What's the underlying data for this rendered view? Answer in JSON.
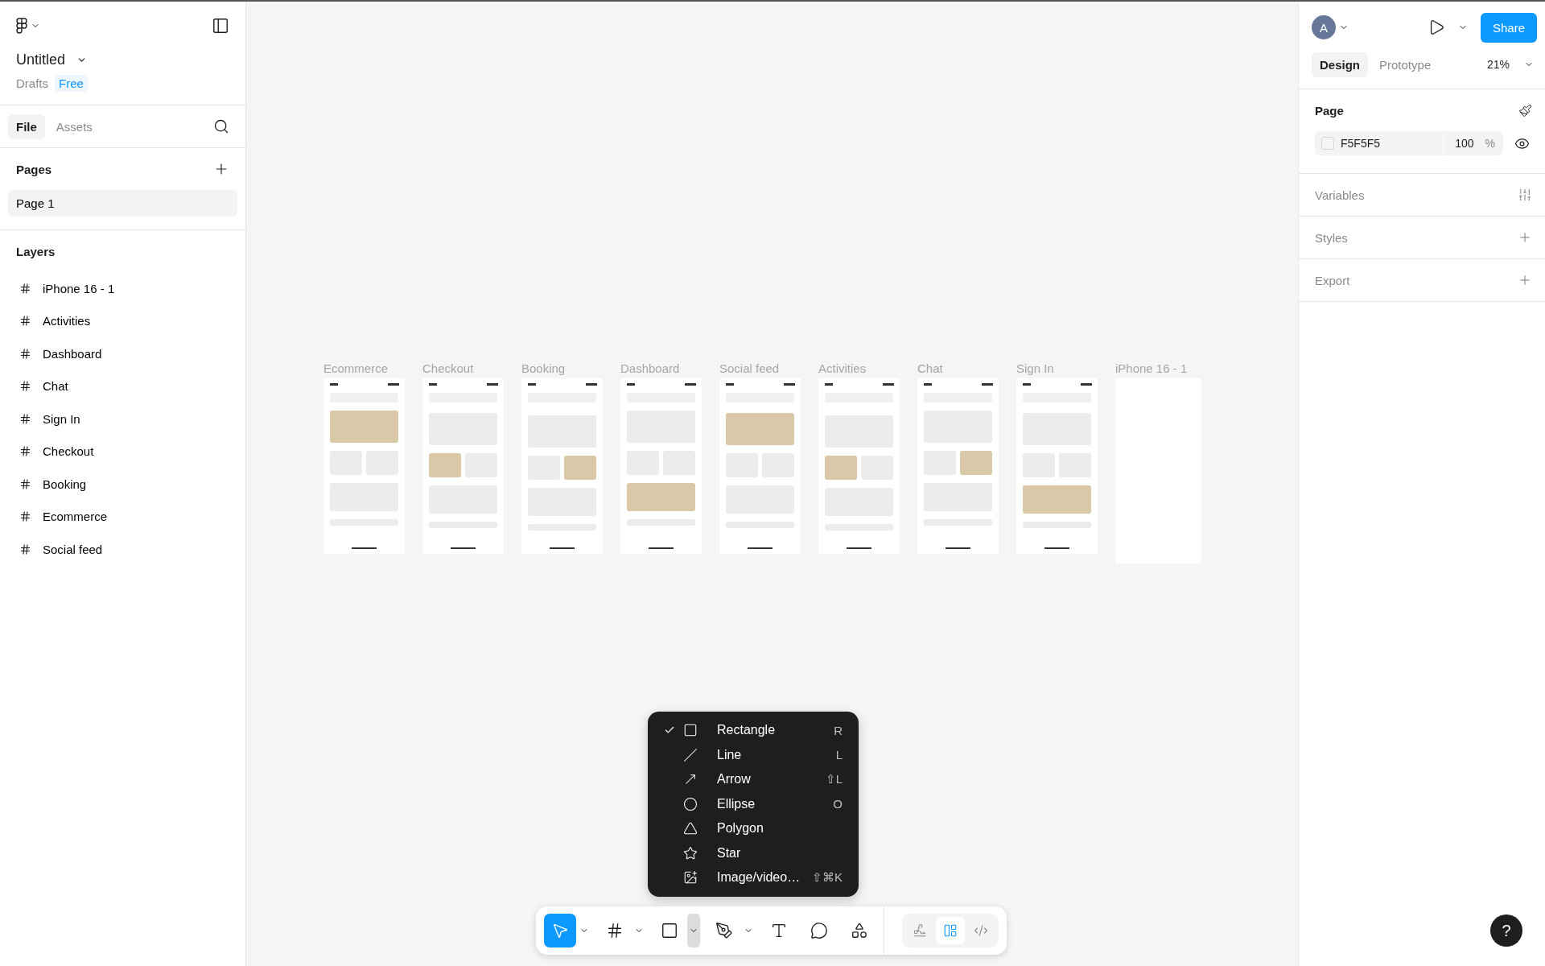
{
  "file": {
    "title": "Untitled",
    "location": "Drafts",
    "plan": "Free"
  },
  "left_tabs": [
    {
      "label": "File",
      "selected": true
    },
    {
      "label": "Assets",
      "selected": false
    }
  ],
  "pages": {
    "heading": "Pages",
    "items": [
      {
        "label": "Page 1",
        "selected": true
      }
    ]
  },
  "layers": {
    "heading": "Layers",
    "items": [
      {
        "label": "iPhone 16 - 1"
      },
      {
        "label": "Activities"
      },
      {
        "label": "Dashboard"
      },
      {
        "label": "Chat"
      },
      {
        "label": "Sign In"
      },
      {
        "label": "Checkout"
      },
      {
        "label": "Booking"
      },
      {
        "label": "Ecommerce"
      },
      {
        "label": "Social feed"
      }
    ]
  },
  "canvas": {
    "frames": [
      {
        "label": "Ecommerce",
        "kind": "mockup"
      },
      {
        "label": "Checkout",
        "kind": "mockup"
      },
      {
        "label": "Booking",
        "kind": "mockup"
      },
      {
        "label": "Dashboard",
        "kind": "mockup"
      },
      {
        "label": "Social feed",
        "kind": "mockup"
      },
      {
        "label": "Activities",
        "kind": "mockup"
      },
      {
        "label": "Chat",
        "kind": "mockup"
      },
      {
        "label": "Sign In",
        "kind": "mockup"
      },
      {
        "label": "iPhone 16 - 1",
        "kind": "blank"
      }
    ]
  },
  "shape_menu": {
    "items": [
      {
        "kind": "rectangle",
        "label": "Rectangle",
        "shortcut": "R",
        "checked": true
      },
      {
        "kind": "line",
        "label": "Line",
        "shortcut": "L",
        "checked": false
      },
      {
        "kind": "arrow",
        "label": "Arrow",
        "shortcut": "⇧L",
        "checked": false
      },
      {
        "kind": "ellipse",
        "label": "Ellipse",
        "shortcut": "O",
        "checked": false
      },
      {
        "kind": "polygon",
        "label": "Polygon",
        "checked": false
      },
      {
        "kind": "star",
        "label": "Star",
        "checked": false
      },
      {
        "kind": "image",
        "label": "Image/video…",
        "shortcut": "⇧⌘K",
        "checked": false
      }
    ]
  },
  "toolbar": {
    "tools": [
      {
        "kind": "move",
        "selected": true,
        "menu_open": false
      },
      {
        "kind": "frame",
        "selected": false,
        "menu_open": false
      },
      {
        "kind": "rectangle",
        "selected": false,
        "menu_open": true
      },
      {
        "kind": "pen",
        "selected": false,
        "menu_open": false
      },
      {
        "kind": "text",
        "selected": false
      },
      {
        "kind": "comment",
        "selected": false
      },
      {
        "kind": "actions",
        "selected": false
      }
    ],
    "modes": [
      {
        "kind": "draw",
        "selected": false
      },
      {
        "kind": "design",
        "selected": true
      },
      {
        "kind": "dev",
        "selected": false
      }
    ]
  },
  "header": {
    "avatar": "A",
    "share": "Share"
  },
  "right_tabs": [
    {
      "label": "Design",
      "selected": true
    },
    {
      "label": "Prototype",
      "selected": false
    }
  ],
  "zoom": "21%",
  "page_section": {
    "heading": "Page",
    "fill": "F5F5F5",
    "opacity": "100",
    "unit": "%",
    "visible": true
  },
  "sections": [
    {
      "kind": "variables",
      "label": "Variables"
    },
    {
      "kind": "styles",
      "label": "Styles"
    },
    {
      "kind": "export",
      "label": "Export"
    }
  ],
  "help": "?"
}
